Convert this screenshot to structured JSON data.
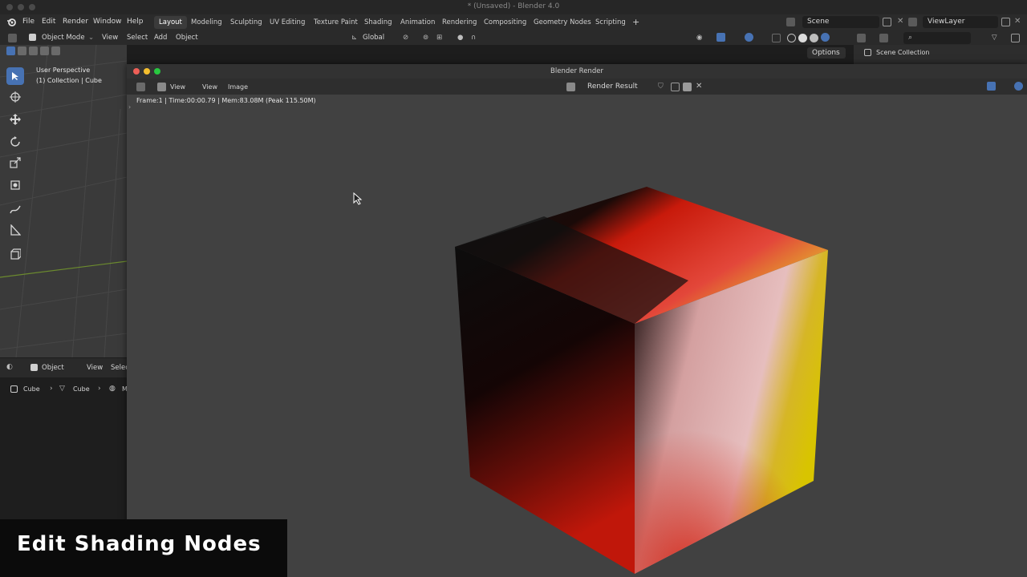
{
  "app": {
    "window_title": "* (Unsaved) - Blender 4.0"
  },
  "menu": [
    "File",
    "Edit",
    "Render",
    "Window",
    "Help"
  ],
  "workspaces": [
    "Layout",
    "Modeling",
    "Sculpting",
    "UV Editing",
    "Texture Paint",
    "Shading",
    "Animation",
    "Rendering",
    "Compositing",
    "Geometry Nodes",
    "Scripting"
  ],
  "active_workspace": "Layout",
  "scene": {
    "name": "Scene",
    "view_layer": "ViewLayer"
  },
  "viewport_header": {
    "mode": "Object Mode",
    "menus": [
      "View",
      "Select",
      "Add",
      "Object"
    ],
    "orientation": "Global",
    "options": "Options"
  },
  "viewport": {
    "perspective": "User Perspective",
    "collection": "(1) Collection | Cube"
  },
  "outliner": {
    "root": "Scene Collection"
  },
  "lower_editor": {
    "mode": "Object",
    "menus": [
      "View",
      "Selec"
    ],
    "breadcrumb": [
      "Cube",
      "Cube",
      "M"
    ]
  },
  "render_window": {
    "title": "Blender Render",
    "menus": [
      "View",
      "View",
      "Image"
    ],
    "slot": "Render Result",
    "stats": "Frame:1 | Time:00:00.79 | Mem:83.08M (Peak 115.50M)"
  },
  "caption": "Edit Shading Nodes",
  "colors": {
    "accent": "#4772b3",
    "cube_red": "#d0190c",
    "cube_yellow": "#d9c400"
  }
}
